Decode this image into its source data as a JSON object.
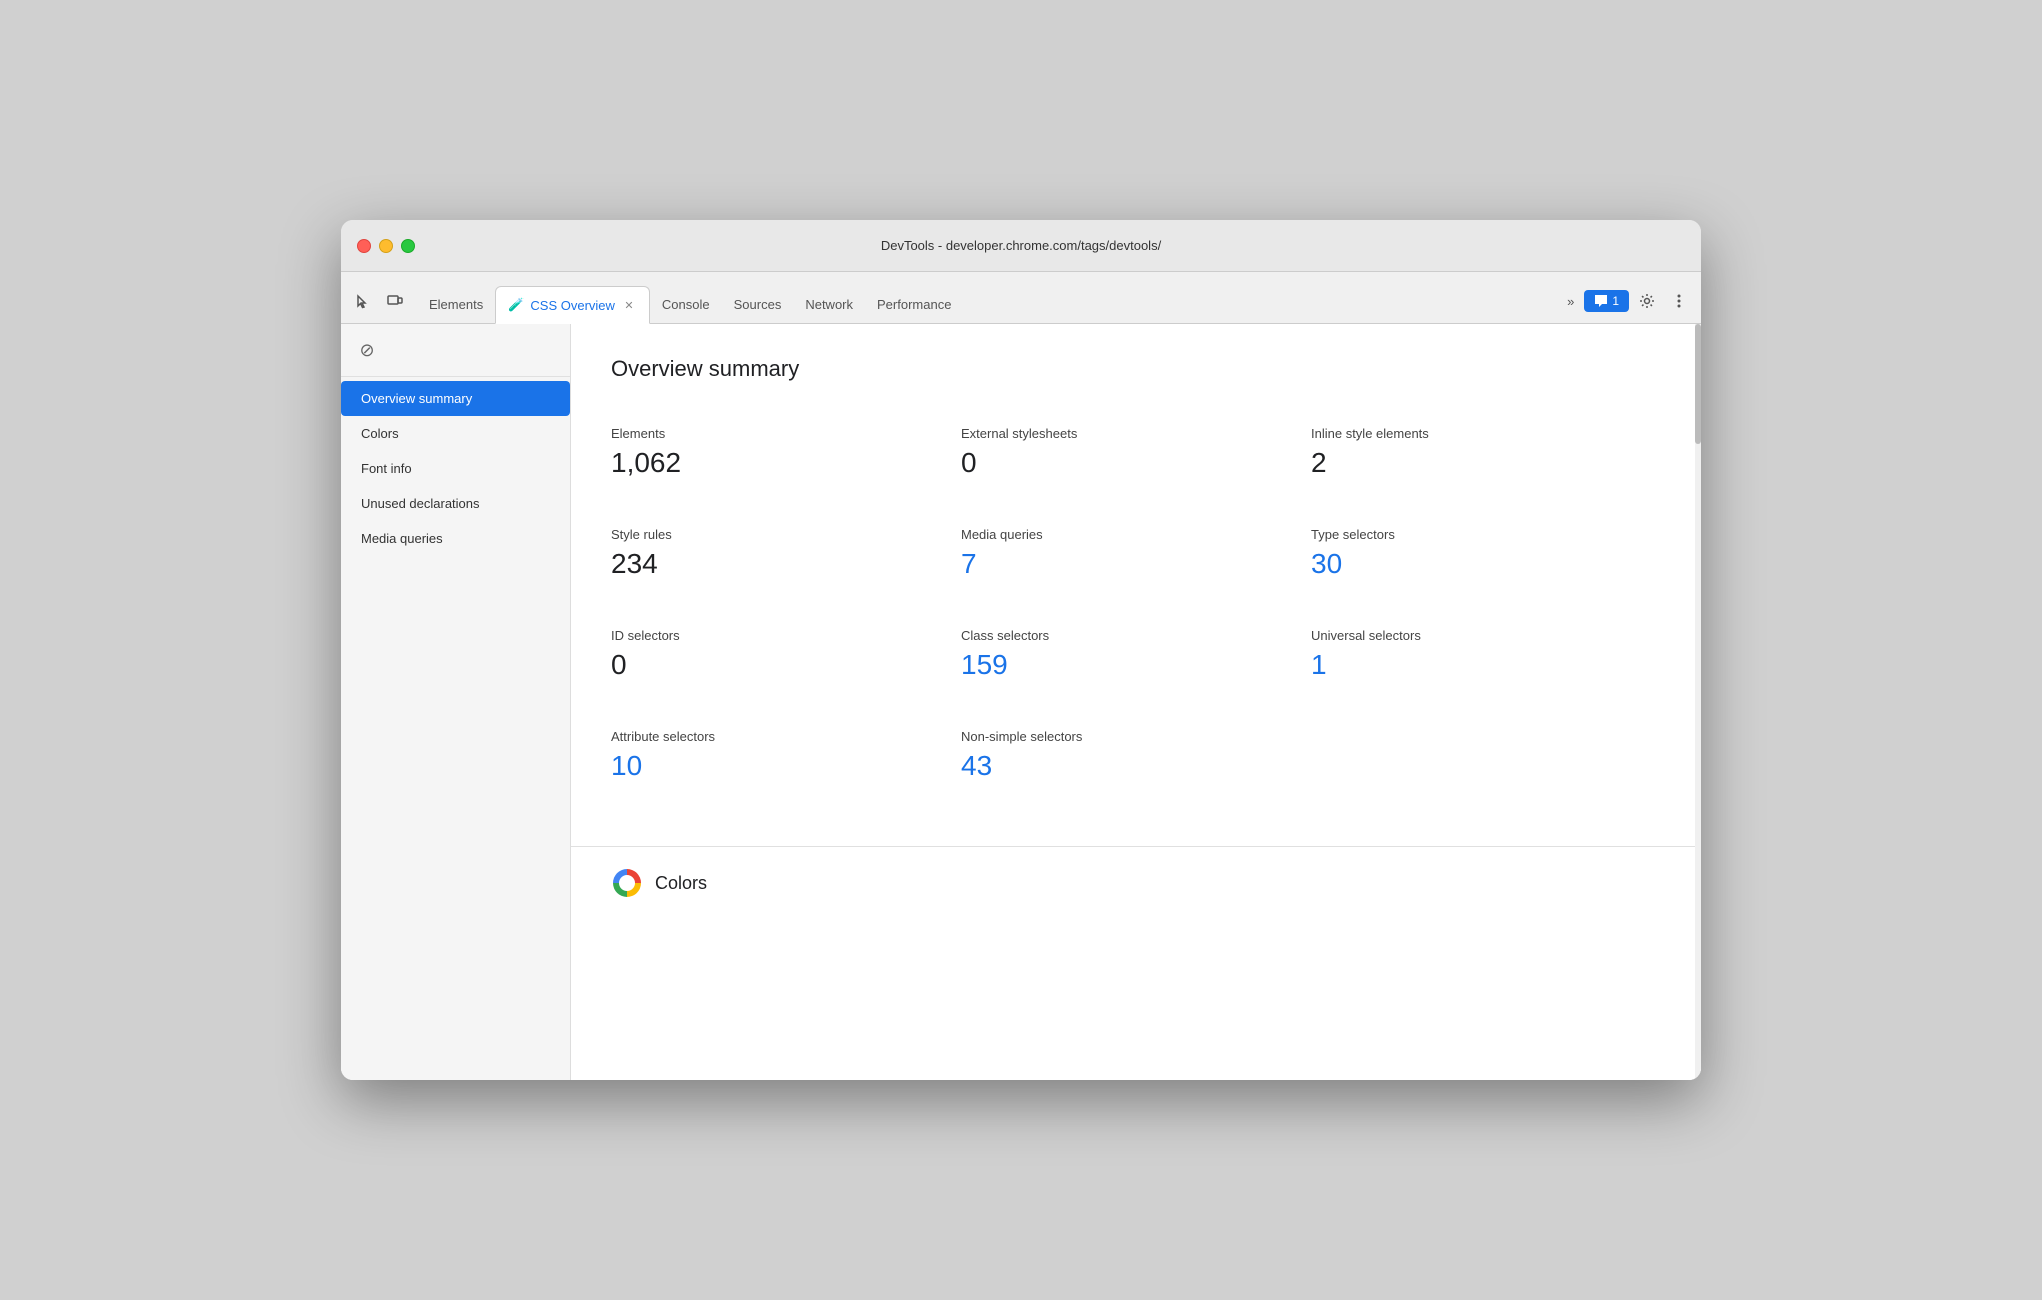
{
  "window": {
    "title": "DevTools - developer.chrome.com/tags/devtools/"
  },
  "tabs": [
    {
      "id": "elements",
      "label": "Elements",
      "active": false,
      "closable": false
    },
    {
      "id": "css-overview",
      "label": "CSS Overview",
      "active": true,
      "closable": true,
      "has_icon": true
    },
    {
      "id": "console",
      "label": "Console",
      "active": false,
      "closable": false
    },
    {
      "id": "sources",
      "label": "Sources",
      "active": false,
      "closable": false
    },
    {
      "id": "network",
      "label": "Network",
      "active": false,
      "closable": false
    },
    {
      "id": "performance",
      "label": "Performance",
      "active": false,
      "closable": false
    }
  ],
  "tab_bar": {
    "more_label": "»",
    "feedback_count": "1",
    "feedback_label": "1"
  },
  "sidebar": {
    "block_icon": "🚫",
    "items": [
      {
        "id": "overview-summary",
        "label": "Overview summary",
        "active": true
      },
      {
        "id": "colors",
        "label": "Colors",
        "active": false
      },
      {
        "id": "font-info",
        "label": "Font info",
        "active": false
      },
      {
        "id": "unused-declarations",
        "label": "Unused declarations",
        "active": false
      },
      {
        "id": "media-queries",
        "label": "Media queries",
        "active": false
      }
    ]
  },
  "main": {
    "section_title": "Overview summary",
    "stats": [
      {
        "row": [
          {
            "label": "Elements",
            "value": "1,062",
            "clickable": false
          },
          {
            "label": "External stylesheets",
            "value": "0",
            "clickable": false
          },
          {
            "label": "Inline style elements",
            "value": "2",
            "clickable": false
          }
        ]
      },
      {
        "row": [
          {
            "label": "Style rules",
            "value": "234",
            "clickable": false
          },
          {
            "label": "Media queries",
            "value": "7",
            "clickable": true
          },
          {
            "label": "Type selectors",
            "value": "30",
            "clickable": true
          }
        ]
      },
      {
        "row": [
          {
            "label": "ID selectors",
            "value": "0",
            "clickable": false
          },
          {
            "label": "Class selectors",
            "value": "159",
            "clickable": true
          },
          {
            "label": "Universal selectors",
            "value": "1",
            "clickable": true
          }
        ]
      },
      {
        "row": [
          {
            "label": "Attribute selectors",
            "value": "10",
            "clickable": true
          },
          {
            "label": "Non-simple selectors",
            "value": "43",
            "clickable": true
          },
          {
            "label": "",
            "value": "",
            "clickable": false
          }
        ]
      }
    ],
    "colors_title": "Colors"
  }
}
